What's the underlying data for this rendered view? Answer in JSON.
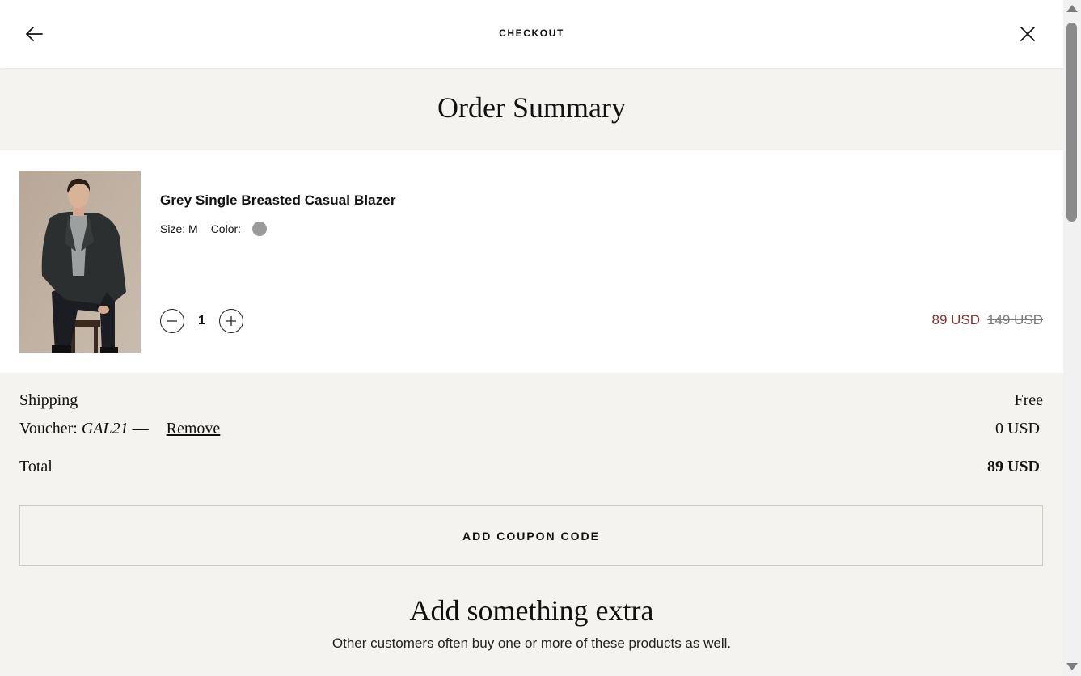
{
  "header": {
    "title": "CHECKOUT",
    "back_icon": "arrow-left-icon",
    "close_icon": "close-icon"
  },
  "summary": {
    "title": "Order Summary"
  },
  "product": {
    "name": "Grey Single Breasted Casual Blazer",
    "size_label": "Size: M",
    "color_label": "Color:",
    "color_swatch": "#9a9a9a",
    "quantity": "1",
    "sale_price": "89 USD",
    "original_price": "149 USD",
    "sale_color": "#8b2e2e"
  },
  "totals": {
    "shipping_label": "Shipping",
    "shipping_value": "Free",
    "voucher_label": "Voucher:",
    "voucher_code": "GAL21",
    "voucher_dash": "—",
    "remove_label": "Remove",
    "voucher_value": "0 USD",
    "total_label": "Total",
    "total_value": "89 USD"
  },
  "coupon": {
    "button_label": "ADD COUPON CODE"
  },
  "extra": {
    "title": "Add something extra",
    "subtitle": "Other customers often buy one or more of these products as well."
  }
}
